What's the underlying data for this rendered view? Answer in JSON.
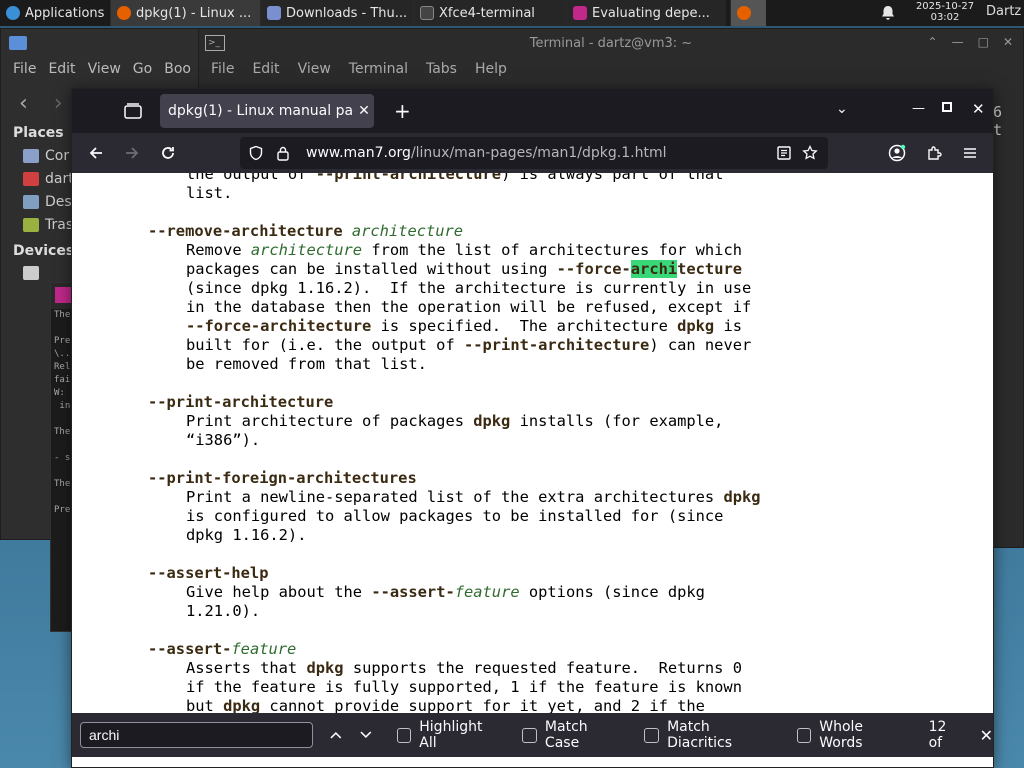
{
  "panel": {
    "applications": "Applications",
    "tasks": [
      "dpkg(1) - Linux ...",
      "Downloads - Thu...",
      "Xfce4-terminal",
      "Evaluating depe..."
    ],
    "clock_date": "2025-10-27",
    "clock_time": "03:02",
    "user": "Dartz"
  },
  "filemanager": {
    "menu": [
      "File",
      "Edit",
      "View",
      "Go",
      "Boo"
    ],
    "places_header": "Places",
    "places": [
      "Cor",
      "dart",
      "Des",
      "Tras"
    ],
    "devices_header": "Devices"
  },
  "terminal": {
    "title": "Terminal - dartz@vm3: ~",
    "menu": [
      "File",
      "Edit",
      "View",
      "Terminal",
      "Tabs",
      "Help"
    ],
    "side_text": "6\nt"
  },
  "xterm_lines": "The\n\nPre\n\\..\nRel\nfai\nW:\n in\n\nThe\n\n- s\n\nThe\n\nPre",
  "firefox": {
    "tab_title": "dpkg(1) - Linux manual page",
    "url_host": "www.man7.org",
    "url_path": "/linux/man-pages/man1/dpkg.1.html"
  },
  "findbar": {
    "query": "archi",
    "highlight_all": "Highlight All",
    "match_case": "Match Case",
    "match_diacritics": "Match Diacritics",
    "whole_words": "Whole Words",
    "count": "12 of"
  },
  "colors": {
    "firefox_chrome": "#2b2a33",
    "tab_active": "#42414d",
    "find_highlight": "#38d878",
    "bold_text": "#3a2a12",
    "italic_text": "#2f6b2f"
  }
}
